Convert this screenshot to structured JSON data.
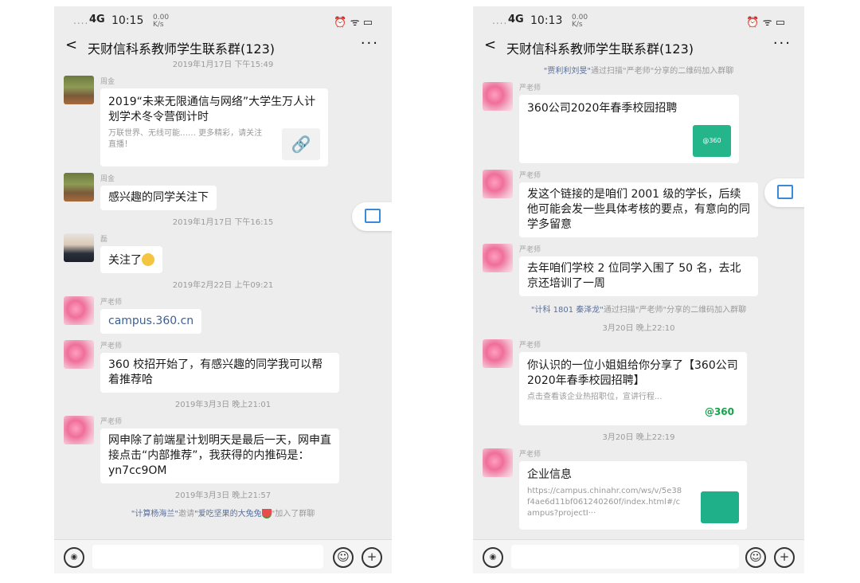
{
  "left": {
    "status": {
      "signal": "....",
      "net": "4G",
      "time": "10:15",
      "speed": "0.00\nK/s",
      "icons": "⏰ ᯤ ▭"
    },
    "title": "天财信科系教师学生联系群(123)",
    "back": "<",
    "more": "···",
    "ts_top": "2019年1月17日 下午15:49",
    "msg1": {
      "sender": "周金",
      "title": "2019“未来无限通信与网络”大学生万人计划学术冬令营倒计时",
      "desc": "万联世界、无线可能…… 更多精彩，请关注直播！"
    },
    "msg2": {
      "sender": "周金",
      "text": "感兴趣的同学关注下"
    },
    "ts2": "2019年1月17日 下午16:15",
    "msg3": {
      "sender": "磊",
      "text": "关注了"
    },
    "ts3": "2019年2月22日 上午09:21",
    "msg4": {
      "sender": "严老师",
      "text": "campus.360.cn"
    },
    "msg5": {
      "sender": "严老师",
      "text": "360 校招开始了，有感兴趣的同学我可以帮着推荐哈"
    },
    "ts4": "2019年3月3日 晚上21:01",
    "msg6": {
      "sender": "严老师",
      "text": "网申除了前端星计划明天是最后一天，网申直接点击“内部推荐”，我获得的内推码是：yn7cc9OM"
    },
    "ts5": "2019年3月3日 晚上21:57",
    "sys": {
      "name": "\"计算杨海兰\"",
      "mid": "邀请",
      "name2": "\"爱吃坚果的大兔兔",
      "tail": "\"加入了群聊"
    }
  },
  "right": {
    "status": {
      "signal": "....",
      "net": "4G",
      "time": "10:13",
      "speed": "0.00\nK/s",
      "icons": "⏰ ᯤ ▭"
    },
    "title": "天财信科系教师学生联系群(123)",
    "back": "<",
    "more": "···",
    "sys1": {
      "name": "\"贾利利刘旻\"",
      "tail": "通过扫描\"严老师\"分享的二维码加入群聊"
    },
    "msg1": {
      "sender": "严老师",
      "title": "360公司2020年春季校园招聘",
      "thumb": "@360"
    },
    "msg2": {
      "sender": "严老师",
      "text": "发这个链接的是咱们 2001 级的学长，后续他可能会发一些具体考核的要点，有意向的同学多留意"
    },
    "msg3": {
      "sender": "严老师",
      "text": "去年咱们学校 2 位同学入围了 50 名，去北京还培训了一周"
    },
    "sys2": {
      "name": "\"计科 1801 秦泽龙\"",
      "tail": "通过扫描\"严老师\"分享的二维码加入群聊"
    },
    "ts1": "3月20日 晚上22:10",
    "msg4": {
      "sender": "严老师",
      "title": "你认识的一位小姐姐给你分享了【360公司2020年春季校园招聘】",
      "desc": "点击查看该企业热招职位，宣讲行程...",
      "logo": "@360"
    },
    "ts2": "3月20日 晚上22:19",
    "msg5": {
      "sender": "严老师",
      "title": "企业信息",
      "desc": "https://campus.chinahr.com/ws/v/5e38f4ae6d11bf061240260f/index.html#/campus?projectI···"
    }
  }
}
